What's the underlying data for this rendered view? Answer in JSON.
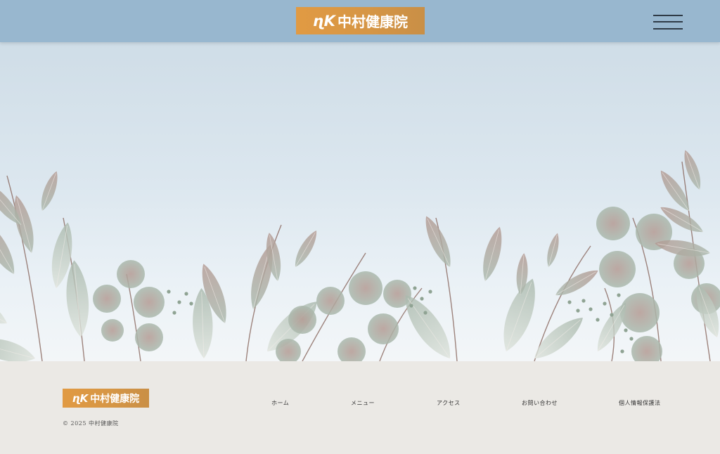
{
  "header": {
    "logo": {
      "mark": "ɳK",
      "text": "中村健康院"
    },
    "menu_button": "hamburger-menu"
  },
  "colors": {
    "header_bg": "#98b7cf",
    "logo_bg": "#dc9944",
    "footer_bg": "#ebe9e5",
    "leaf_grey_green": "#aab9ad",
    "leaf_mauve": "#b49a93"
  },
  "footer": {
    "logo": {
      "mark": "ɳK",
      "text": "中村健康院"
    },
    "copyright": "© 2025 中村健康院",
    "nav": [
      {
        "label": "ホーム"
      },
      {
        "label": "メニュー"
      },
      {
        "label": "アクセス"
      },
      {
        "label": "お問い合わせ"
      },
      {
        "label": "個人情報保護法"
      }
    ]
  }
}
